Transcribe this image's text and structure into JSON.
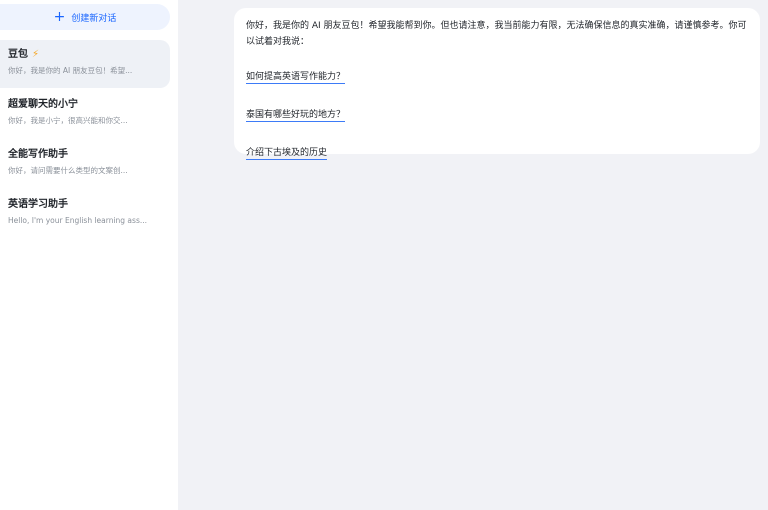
{
  "sidebar": {
    "new_chat_label": "创建新对话",
    "conversations": [
      {
        "title": "豆包",
        "preview": "你好，我是你的 AI 朋友豆包！希望...",
        "badge_icon": "lightning-icon"
      },
      {
        "title": "超爱聊天的小宁",
        "preview": "你好，我是小宁，很高兴能和你交..."
      },
      {
        "title": "全能写作助手",
        "preview": "你好，请问需要什么类型的文案创..."
      },
      {
        "title": "英语学习助手",
        "preview": "Hello, I'm your English learning ass..."
      }
    ]
  },
  "chat": {
    "greeting": "你好，我是你的 AI 朋友豆包！希望我能帮到你。但也请注意，我当前能力有限，无法确保信息的真实准确，请谨慎参考。你可以试着对我说：",
    "suggestions": [
      "如何提高英语写作能力？",
      "泰国有哪些好玩的地方？",
      "介绍下古埃及的历史"
    ]
  },
  "colors": {
    "accent": "#1a66ff",
    "active_item_bg": "#eef1f6",
    "main_bg": "#f1f2f6"
  }
}
